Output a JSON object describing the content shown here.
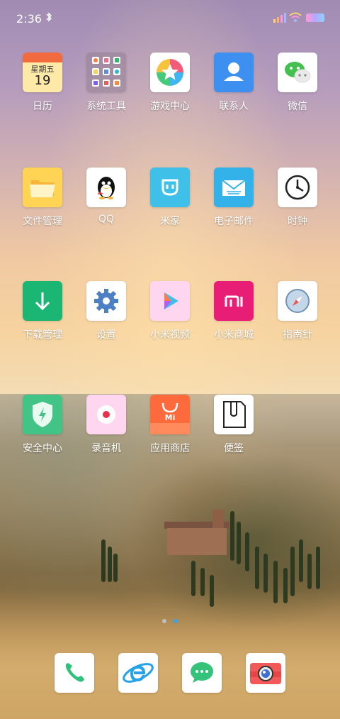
{
  "status_bar": {
    "time": "2:36"
  },
  "icons": {
    "bluetooth": "bluetooth-icon",
    "signal": "signal-icon",
    "wifi": "wifi-icon",
    "battery": "battery-icon"
  },
  "calendar": {
    "weekday": "星期五",
    "day": "19"
  },
  "apps": [
    {
      "label": "日历"
    },
    {
      "label": "系统工具"
    },
    {
      "label": "游戏中心"
    },
    {
      "label": "联系人"
    },
    {
      "label": "微信"
    },
    {
      "label": "文件管理"
    },
    {
      "label": "QQ"
    },
    {
      "label": "米家"
    },
    {
      "label": "电子邮件"
    },
    {
      "label": "时钟"
    },
    {
      "label": "下载管理"
    },
    {
      "label": "设置"
    },
    {
      "label": "小米视频"
    },
    {
      "label": "小米商城"
    },
    {
      "label": "指南针"
    },
    {
      "label": "安全中心"
    },
    {
      "label": "录音机"
    },
    {
      "label": "应用商店"
    },
    {
      "label": "便签"
    }
  ],
  "mi_store_text": "Mi",
  "page_indicator": {
    "pages": 2,
    "current": 2
  },
  "colors": {
    "page_dot_active": "#3aa4e8",
    "page_dot_inactive": "#bfbfbf"
  },
  "dock": [
    "phone-app",
    "browser-app",
    "messages-app",
    "camera-app"
  ]
}
